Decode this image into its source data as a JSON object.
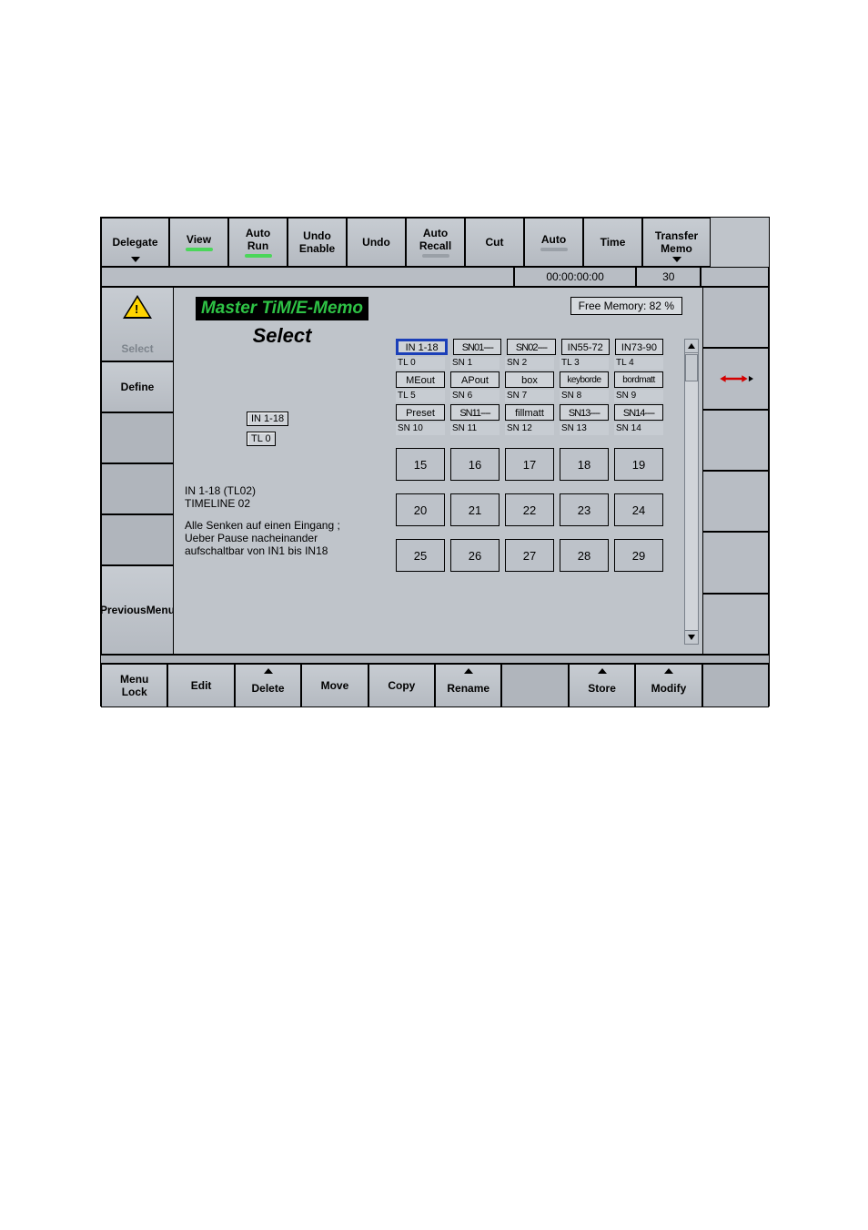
{
  "top": {
    "delegate": "Delegate",
    "view": "View",
    "autorun1": "Auto",
    "autorun2": "Run",
    "undoenable1": "Undo",
    "undoenable2": "Enable",
    "undo": "Undo",
    "autorecall1": "Auto",
    "autorecall2": "Recall",
    "cut": "Cut",
    "auto": "Auto",
    "time": "Time",
    "transfer1": "Transfer",
    "transfer2": "Memo"
  },
  "sec": {
    "time": "00:00:00:00",
    "num": "30"
  },
  "left": {
    "select": "Select",
    "define": "Define",
    "prev1": "Previous",
    "prev2": "Menu"
  },
  "center": {
    "titleA": "Master TiM/E-Memo",
    "titleB": "Select",
    "tag1": "IN 1-18",
    "tag2": "TL 0",
    "desc1": "IN 1-18  (TL02)",
    "desc2": "TIMELINE 02",
    "desc3": "Alle Senken auf einen Eingang ;",
    "desc4": "Ueber Pause nacheinander",
    "desc5": "aufschaltbar von IN1 bis IN18"
  },
  "grid": {
    "freemem": "Free Memory: 82 %",
    "r1": [
      "IN 1-18",
      "SN01----",
      "SN02----",
      "IN55-72",
      "IN73-90"
    ],
    "t1": [
      "TL 0",
      "SN 1",
      "SN 2",
      "TL 3",
      "TL 4"
    ],
    "r2": [
      "MEout",
      "APout",
      "box",
      "keyborde",
      "bordmatt"
    ],
    "t2": [
      "TL 5",
      "SN 6",
      "SN 7",
      "SN 8",
      "SN 9"
    ],
    "r3": [
      "Preset",
      "SN11----",
      "fillmatt",
      "SN13----",
      "SN14----"
    ],
    "t3": [
      "SN 10",
      "SN 11",
      "SN 12",
      "SN 13",
      "SN 14"
    ],
    "r4": [
      "15",
      "16",
      "17",
      "18",
      "19"
    ],
    "r5": [
      "20",
      "21",
      "22",
      "23",
      "24"
    ],
    "r6": [
      "25",
      "26",
      "27",
      "28",
      "29"
    ]
  },
  "bot": {
    "menu1": "Menu",
    "menu2": "Lock",
    "edit": "Edit",
    "delete": "Delete",
    "move": "Move",
    "copy": "Copy",
    "rename": "Rename",
    "store": "Store",
    "modify": "Modify"
  }
}
